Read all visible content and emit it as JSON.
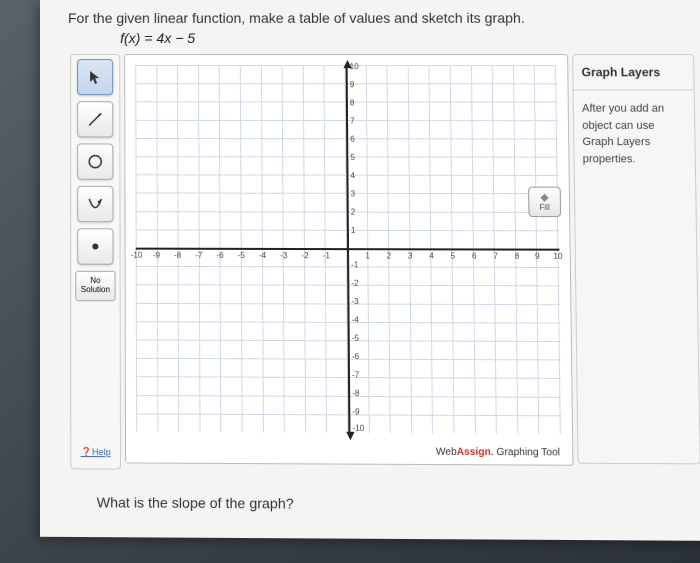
{
  "question": {
    "prompt": "For the given linear function, make a table of values and sketch its graph.",
    "formula": "f(x) = 4x − 5",
    "slope_question": "What is the slope of the graph?"
  },
  "toolbar": {
    "pointer": "pointer",
    "line": "line",
    "circle": "circle",
    "parabola": "parabola",
    "point": "point",
    "no_solution_line1": "No",
    "no_solution_line2": "Solution",
    "help": "Help"
  },
  "canvas": {
    "fill_label": "Fill",
    "brand_prefix": "Web",
    "brand_accent": "Assign",
    "brand_suffix": ". Graphing Tool",
    "axis_ticks_pos": [
      "1",
      "2",
      "3",
      "4",
      "5",
      "6",
      "7",
      "8",
      "9",
      "10"
    ],
    "axis_ticks_neg": [
      "-1",
      "-2",
      "-3",
      "-4",
      "-5",
      "-6",
      "-7",
      "-8",
      "-9",
      "-10"
    ]
  },
  "layers": {
    "title": "Graph Layers",
    "hint": "After you add an object can use Graph Layers properties."
  },
  "chart_data": {
    "type": "line",
    "title": "",
    "xlabel": "",
    "ylabel": "",
    "xlim": [
      -10,
      10
    ],
    "ylim": [
      -10,
      10
    ],
    "grid": true,
    "series": []
  }
}
